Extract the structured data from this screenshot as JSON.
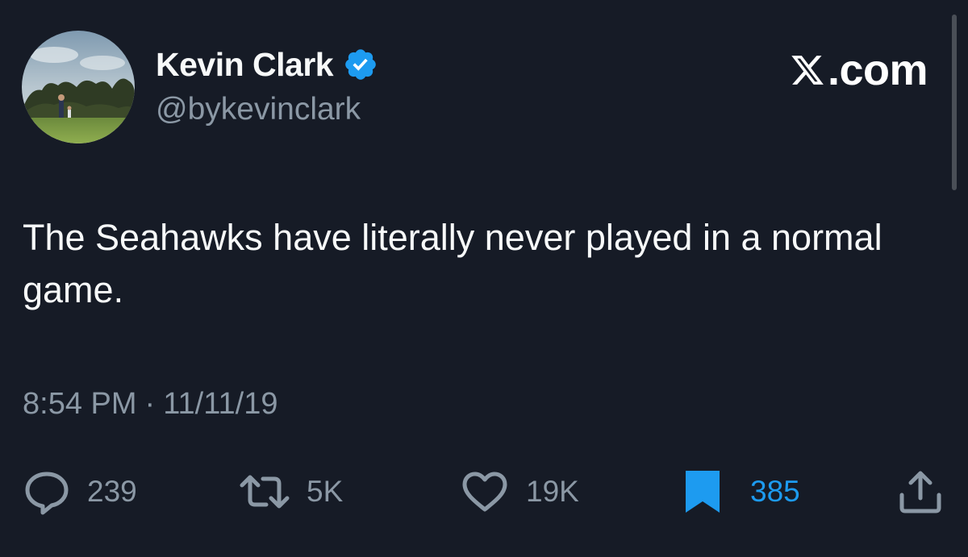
{
  "author": {
    "display_name": "Kevin Clark",
    "handle": "@bykevinclark",
    "verified": true,
    "verified_color": "#1d9bf0",
    "avatar_icon": "profile-photo"
  },
  "brand": {
    "icon": "x-logo-icon",
    "label": ".com"
  },
  "tweet": {
    "text": "The Seahawks have literally never played in a normal game.",
    "time": "8:54 PM",
    "separator": "·",
    "date": "11/11/19"
  },
  "actions": {
    "replies": {
      "icon": "reply-icon",
      "count": "239"
    },
    "retweets": {
      "icon": "retweet-icon",
      "count": "5K"
    },
    "likes": {
      "icon": "heart-icon",
      "count": "19K"
    },
    "bookmarks": {
      "icon": "bookmark-icon",
      "count": "385",
      "active": true,
      "color": "#1d9bf0"
    },
    "share": {
      "icon": "share-icon"
    }
  },
  "colors": {
    "background": "#161b26",
    "primary_text": "#f7f9f9",
    "secondary_text": "#8b98a5",
    "accent": "#1d9bf0"
  }
}
